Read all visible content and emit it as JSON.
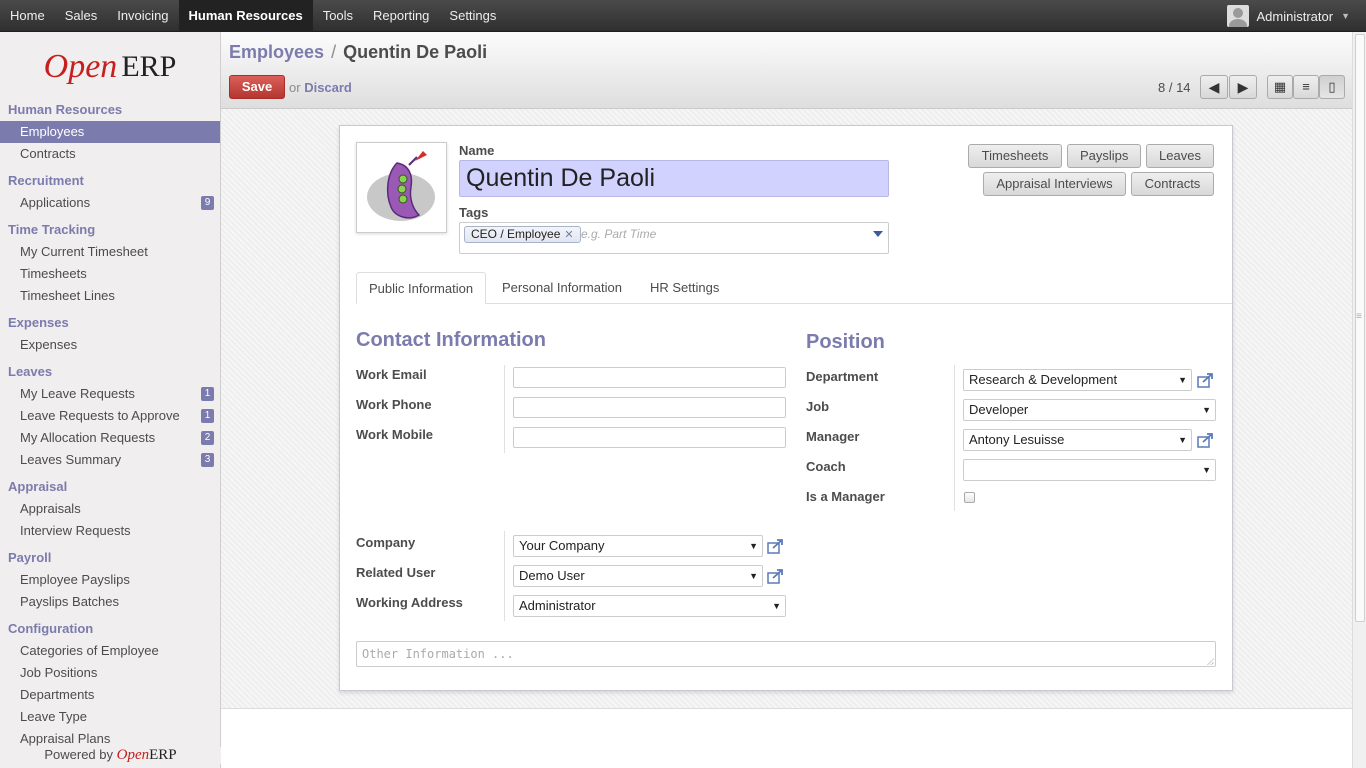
{
  "topnav": {
    "items": [
      "Home",
      "Sales",
      "Invoicing",
      "Human Resources",
      "Tools",
      "Reporting",
      "Settings"
    ],
    "active": "Human Resources",
    "user": "Administrator"
  },
  "logo": {
    "open": "Open",
    "erp": "ERP"
  },
  "sidebar": {
    "sections": [
      {
        "title": "Human Resources",
        "items": [
          {
            "label": "Employees",
            "active": true
          },
          {
            "label": "Contracts"
          }
        ]
      },
      {
        "title": "Recruitment",
        "items": [
          {
            "label": "Applications",
            "badge": "9"
          }
        ]
      },
      {
        "title": "Time Tracking",
        "items": [
          {
            "label": "My Current Timesheet"
          },
          {
            "label": "Timesheets"
          },
          {
            "label": "Timesheet Lines"
          }
        ]
      },
      {
        "title": "Expenses",
        "items": [
          {
            "label": "Expenses"
          }
        ]
      },
      {
        "title": "Leaves",
        "items": [
          {
            "label": "My Leave Requests",
            "badge": "1"
          },
          {
            "label": "Leave Requests to Approve",
            "badge": "1"
          },
          {
            "label": "My Allocation Requests",
            "badge": "2"
          },
          {
            "label": "Leaves Summary",
            "badge": "3"
          }
        ]
      },
      {
        "title": "Appraisal",
        "items": [
          {
            "label": "Appraisals"
          },
          {
            "label": "Interview Requests"
          }
        ]
      },
      {
        "title": "Payroll",
        "items": [
          {
            "label": "Employee Payslips"
          },
          {
            "label": "Payslips Batches"
          }
        ]
      },
      {
        "title": "Configuration",
        "items": [
          {
            "label": "Categories of Employee"
          },
          {
            "label": "Job Positions"
          },
          {
            "label": "Departments"
          },
          {
            "label": "Leave Type"
          },
          {
            "label": "Appraisal Plans"
          }
        ]
      }
    ],
    "powered_by": "Powered by"
  },
  "header": {
    "breadcrumb_parent": "Employees",
    "breadcrumb_sep": "/",
    "breadcrumb_current": "Quentin De Paoli",
    "save_label": "Save",
    "or_label": "or",
    "discard_label": "Discard",
    "pager": "8 / 14"
  },
  "form": {
    "name_label": "Name",
    "name_value": "Quentin De Paoli",
    "tags_label": "Tags",
    "tag_value": "CEO / Employee",
    "tags_placeholder": "e.g. Part Time",
    "buttons": [
      "Timesheets",
      "Payslips",
      "Leaves",
      "Appraisal Interviews",
      "Contracts"
    ],
    "tabs": [
      "Public Information",
      "Personal Information",
      "HR Settings"
    ],
    "contact_title": "Contact Information",
    "work_email_label": "Work Email",
    "work_phone_label": "Work Phone",
    "work_mobile_label": "Work Mobile",
    "position_title": "Position",
    "department_label": "Department",
    "department_value": "Research & Development",
    "job_label": "Job",
    "job_value": "Developer",
    "manager_label": "Manager",
    "manager_value": "Antony Lesuisse",
    "coach_label": "Coach",
    "coach_value": "",
    "is_manager_label": "Is a Manager",
    "is_manager": false,
    "company_label": "Company",
    "company_value": "Your Company",
    "related_user_label": "Related User",
    "related_user_value": "Demo User",
    "working_address_label": "Working Address",
    "working_address_value": "Administrator",
    "other_info_placeholder": "Other Information ..."
  },
  "colors": {
    "accent": "#7c7bad",
    "save": "#c0392b",
    "brand_red": "#c71e1e",
    "name_bg": "#d2d2ff"
  }
}
